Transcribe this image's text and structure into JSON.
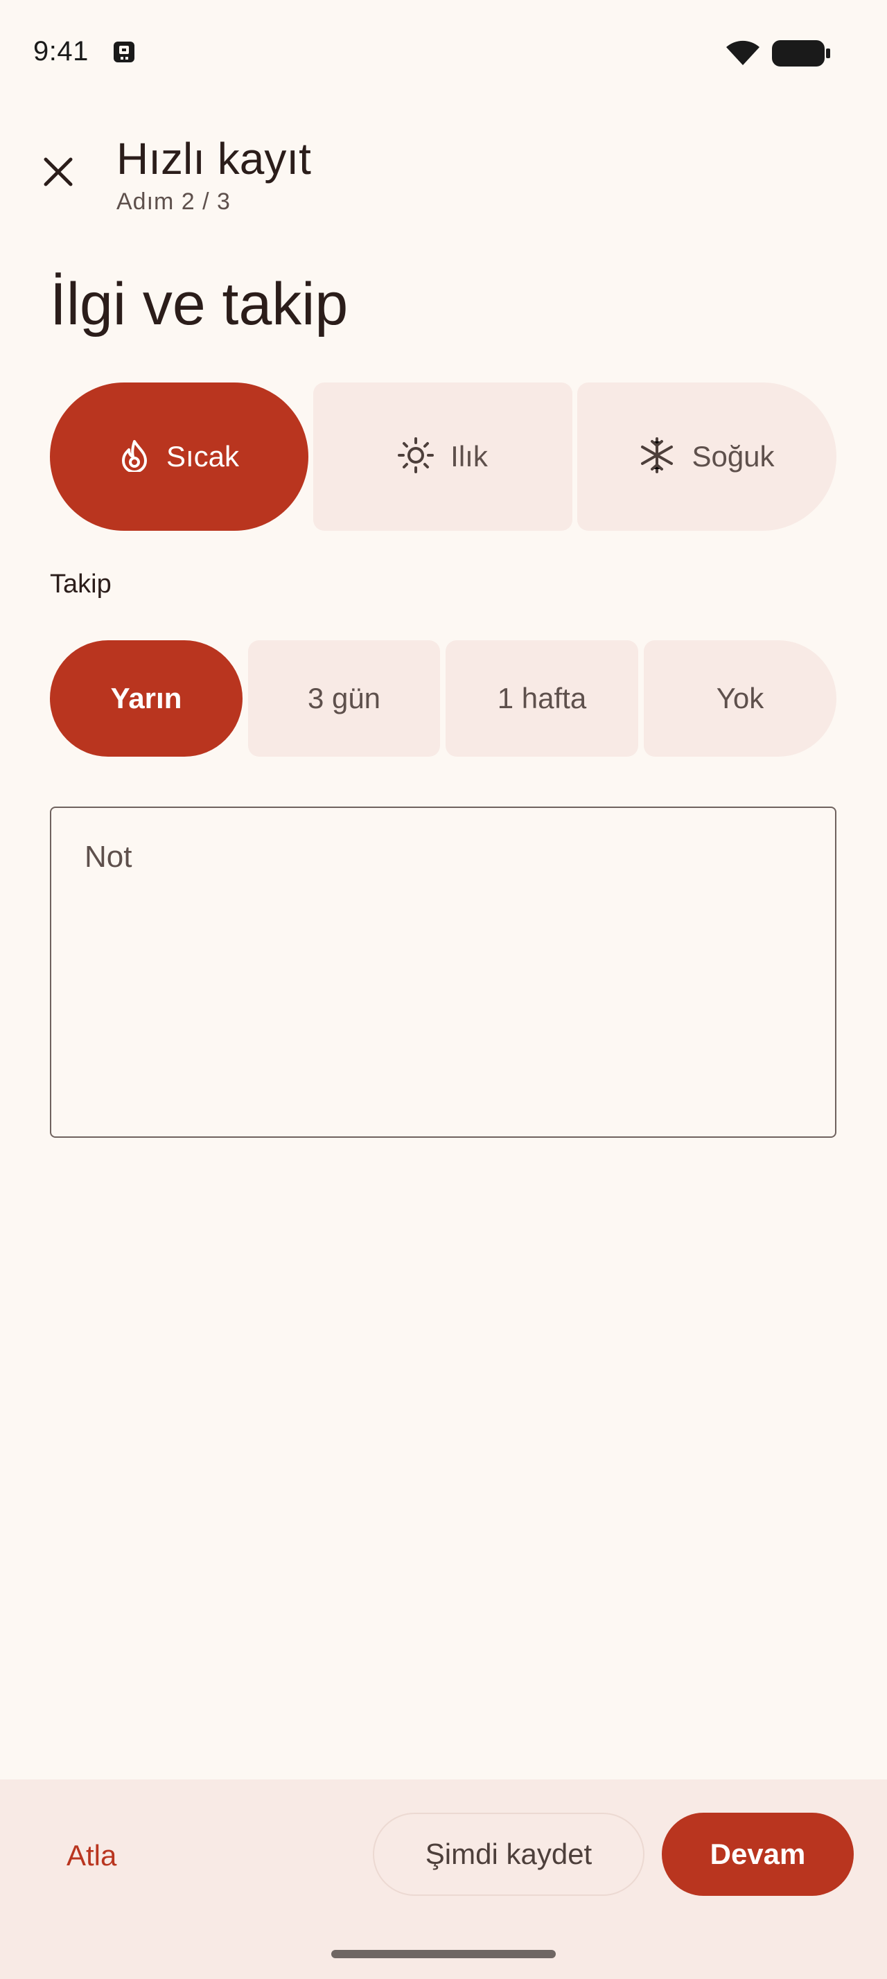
{
  "status_bar": {
    "time": "9:41",
    "icons": [
      "notification-icon",
      "wifi-icon",
      "battery-icon"
    ]
  },
  "header": {
    "close_icon": "close-icon",
    "title": "Hızlı kayıt",
    "subtitle": "Adım 2 / 3"
  },
  "main": {
    "headline": "İlgi ve takip",
    "temperature": {
      "selected": "Sıcak",
      "options": [
        {
          "label": "Sıcak",
          "icon": "flame-icon"
        },
        {
          "label": "Ilık",
          "icon": "sun-icon"
        },
        {
          "label": "Soğuk",
          "icon": "snowflake-icon"
        }
      ]
    },
    "follow_up": {
      "label": "Takip",
      "selected": "Yarın",
      "options": [
        "Yarın",
        "3 gün",
        "1 hafta",
        "Yok"
      ]
    },
    "note": {
      "placeholder": "Not",
      "value": ""
    }
  },
  "bottom_bar": {
    "skip_label": "Atla",
    "save_now_label": "Şimdi kaydet",
    "continue_label": "Devam"
  },
  "colors": {
    "background": "#FDF8F3",
    "accent": "#B9351F",
    "chip_unselected": "#F8EAE5",
    "text": "#2B1D1A"
  }
}
